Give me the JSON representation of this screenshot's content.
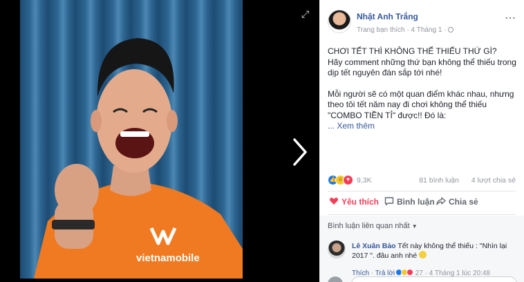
{
  "viewer": {
    "photo_subject": "Selfie of a smiling man in an orange shirt",
    "shirt_brand": "vietnamobile",
    "expand_icon": "expand-arrows-icon",
    "next_icon": "chevron-right-icon"
  },
  "post": {
    "author": "Nhật Anh Trắng",
    "meta_prefix": "Trang bạn thích · 4 Tháng 1 ·",
    "body_line1": "CHƠI TẾT THÌ KHÔNG THỂ THIẾU THỨ GÌ?",
    "body_line2": "Hãy comment những thứ bạn không thể thiếu trong dịp tết nguyên đán sắp tới nhé!",
    "body_para2": "Mỗi người sẽ có một quan điểm khác nhau, nhưng theo tôi tết năm nay đi chơi không thể thiếu \"COMBO TIỀN TỈ\" được!! Đó là:",
    "see_more": "... Xem thêm"
  },
  "stats": {
    "reaction_count": "9,3K",
    "comments": "81 bình luận",
    "shares": "4 lượt chia sẻ"
  },
  "actions": {
    "like": "Yêu thích",
    "comment": "Bình luận",
    "share": "Chia sẻ"
  },
  "comments_section": {
    "sort_label": "Bình luận liên quan nhất",
    "items": [
      {
        "name": "Lê Xuân Bảo",
        "text": "Tết này không thể thiếu : \"Nhìn lại 2017 \". đâu anh nhé",
        "like": "Thích",
        "reply": "Trả lời",
        "reaction_count": "27",
        "time": "4 Tháng 1 lúc 20:48"
      }
    ]
  },
  "colors": {
    "link": "#365899",
    "love_red": "#f33e58",
    "like_blue": "#1877f2",
    "haha_yellow": "#f7c82e",
    "shirt_orange": "#f07a21"
  }
}
